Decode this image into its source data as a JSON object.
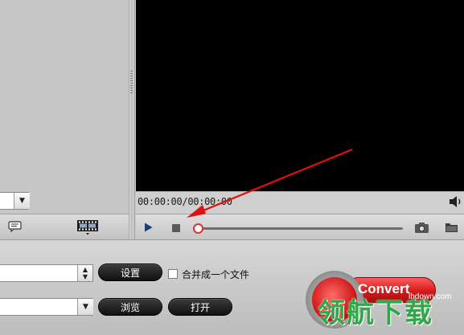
{
  "player": {
    "time_display": "00:00:00/00:00:00"
  },
  "output": {
    "settings_label": "设置",
    "merge_label": "合并成一个文件",
    "browse_label": "浏览",
    "open_label": "打开",
    "convert_label": "Convert"
  },
  "watermark": {
    "url": "lhdown.com",
    "text": "领航下载"
  },
  "colors": {
    "accent_red": "#e0302e",
    "watermark_green": "#2fa84a",
    "video_bg": "#000000"
  }
}
